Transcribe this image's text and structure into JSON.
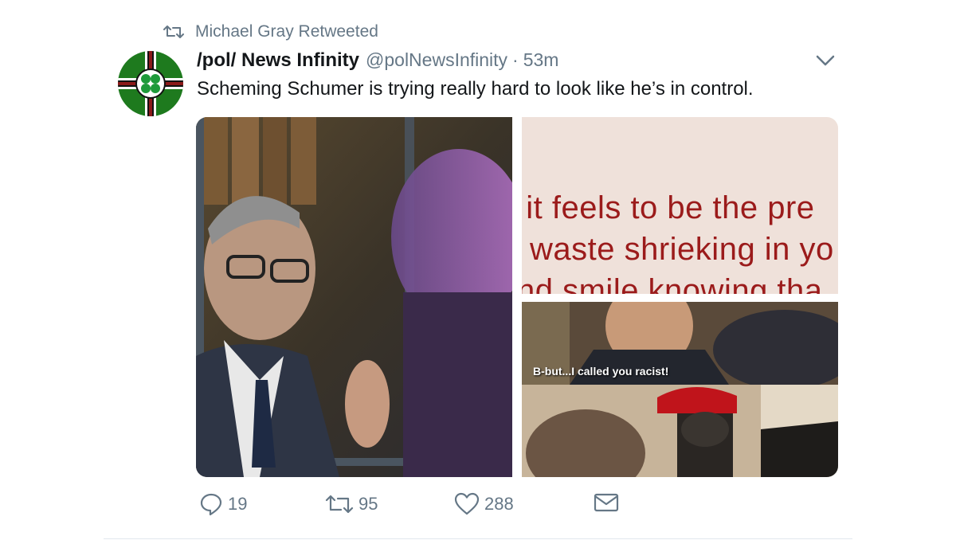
{
  "retweet_context": {
    "icon": "retweet-icon",
    "label": "Michael Gray Retweeted"
  },
  "tweet": {
    "avatar_icon": "flag-shamrock-avatar",
    "display_name": "/pol/ News Infinity",
    "handle": "@polNewsInfinity",
    "separator": "·",
    "timestamp": "53m",
    "caret_icon": "chevron-down-icon",
    "text": "Scheming Schumer is trying really hard to look like he’s in control."
  },
  "media": {
    "top_right_lines": [
      "t it feels to be the pre",
      "waste shrieking in yo",
      "nd smile knowing tha"
    ],
    "bottom_right_caption": "B-but...I called you racist!"
  },
  "actions": {
    "reply": {
      "icon": "reply-icon",
      "count": "19"
    },
    "retweet": {
      "icon": "retweet-icon",
      "count": "95"
    },
    "like": {
      "icon": "heart-icon",
      "count": "288"
    },
    "message": {
      "icon": "envelope-icon"
    }
  },
  "colors": {
    "secondary_text": "#657786",
    "primary_text": "#14171a",
    "meme_text": "#9b1b1b",
    "avatar_green": "#1e7a1e"
  }
}
